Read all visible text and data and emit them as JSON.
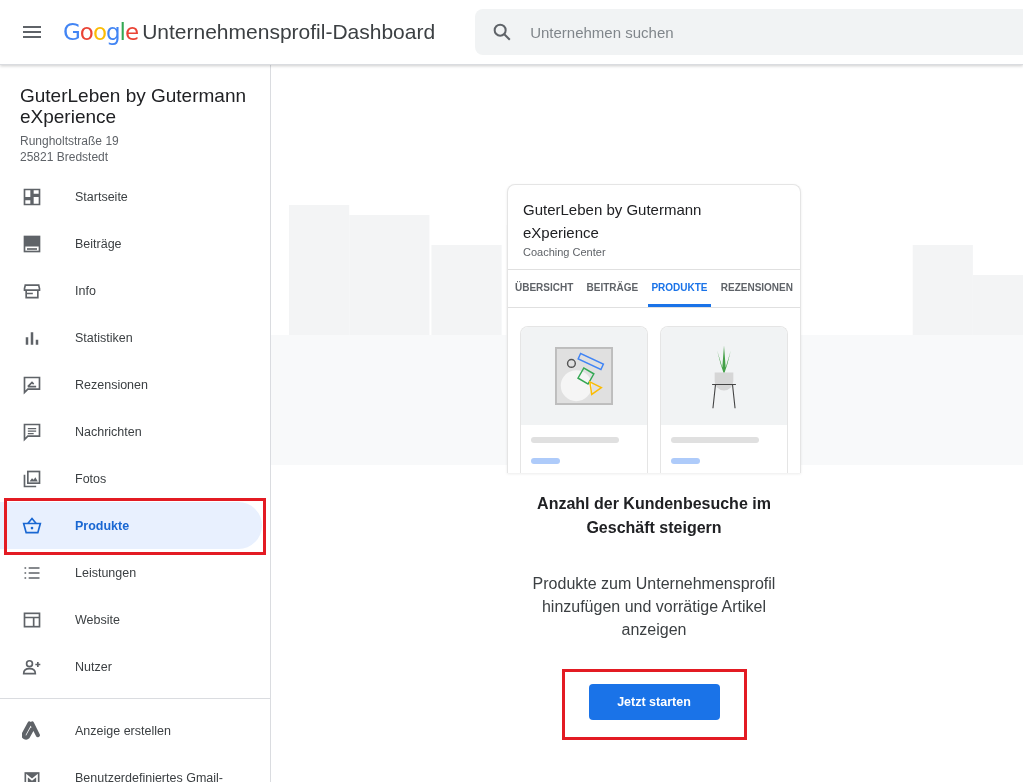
{
  "header": {
    "logo": "Google",
    "product_name": "Unternehmensprofil-Dashboard",
    "search": {
      "placeholder": "Unternehmen suchen"
    }
  },
  "business": {
    "name": "GuterLeben by Gutermann eXperience",
    "address": [
      "Rungholtstraße 19",
      "25821 Bredstedt"
    ]
  },
  "nav": [
    {
      "label": "Startseite",
      "selected": false,
      "highlighted": false
    },
    {
      "label": "Beiträge",
      "selected": false,
      "highlighted": false
    },
    {
      "label": "Info",
      "selected": false,
      "highlighted": false
    },
    {
      "label": "Statistiken",
      "selected": false,
      "highlighted": false
    },
    {
      "label": "Rezensionen",
      "selected": false,
      "highlighted": false
    },
    {
      "label": "Nachrichten",
      "selected": false,
      "highlighted": false
    },
    {
      "label": "Fotos",
      "selected": false,
      "highlighted": false
    },
    {
      "label": "Produkte",
      "selected": true,
      "highlighted": true
    },
    {
      "label": "Leistungen",
      "selected": false,
      "highlighted": false
    },
    {
      "label": "Website",
      "selected": false,
      "highlighted": false
    },
    {
      "label": "Nutzer",
      "selected": false,
      "highlighted": false
    }
  ],
  "nav_secondary": [
    {
      "label": "Anzeige erstellen"
    },
    {
      "label": "Benutzerdefiniertes Gmail-"
    }
  ],
  "preview": {
    "business_name": "GuterLeben by Gutermann eXperience",
    "category": "Coaching Center",
    "tabs": [
      {
        "label": "ÜBERSICHT",
        "selected": false
      },
      {
        "label": "BEITRÄGE",
        "selected": false
      },
      {
        "label": "PRODUKTE",
        "selected": true
      },
      {
        "label": "REZENSIONEN",
        "selected": false
      }
    ]
  },
  "promo": {
    "heading": "Anzahl der Kundenbesuche im Geschäft steigern",
    "text": "Produkte zum Unternehmensprofil hinzufügen und vorrätige Artikel anzeigen",
    "button": {
      "label": "Jetzt starten",
      "highlighted": true
    }
  }
}
